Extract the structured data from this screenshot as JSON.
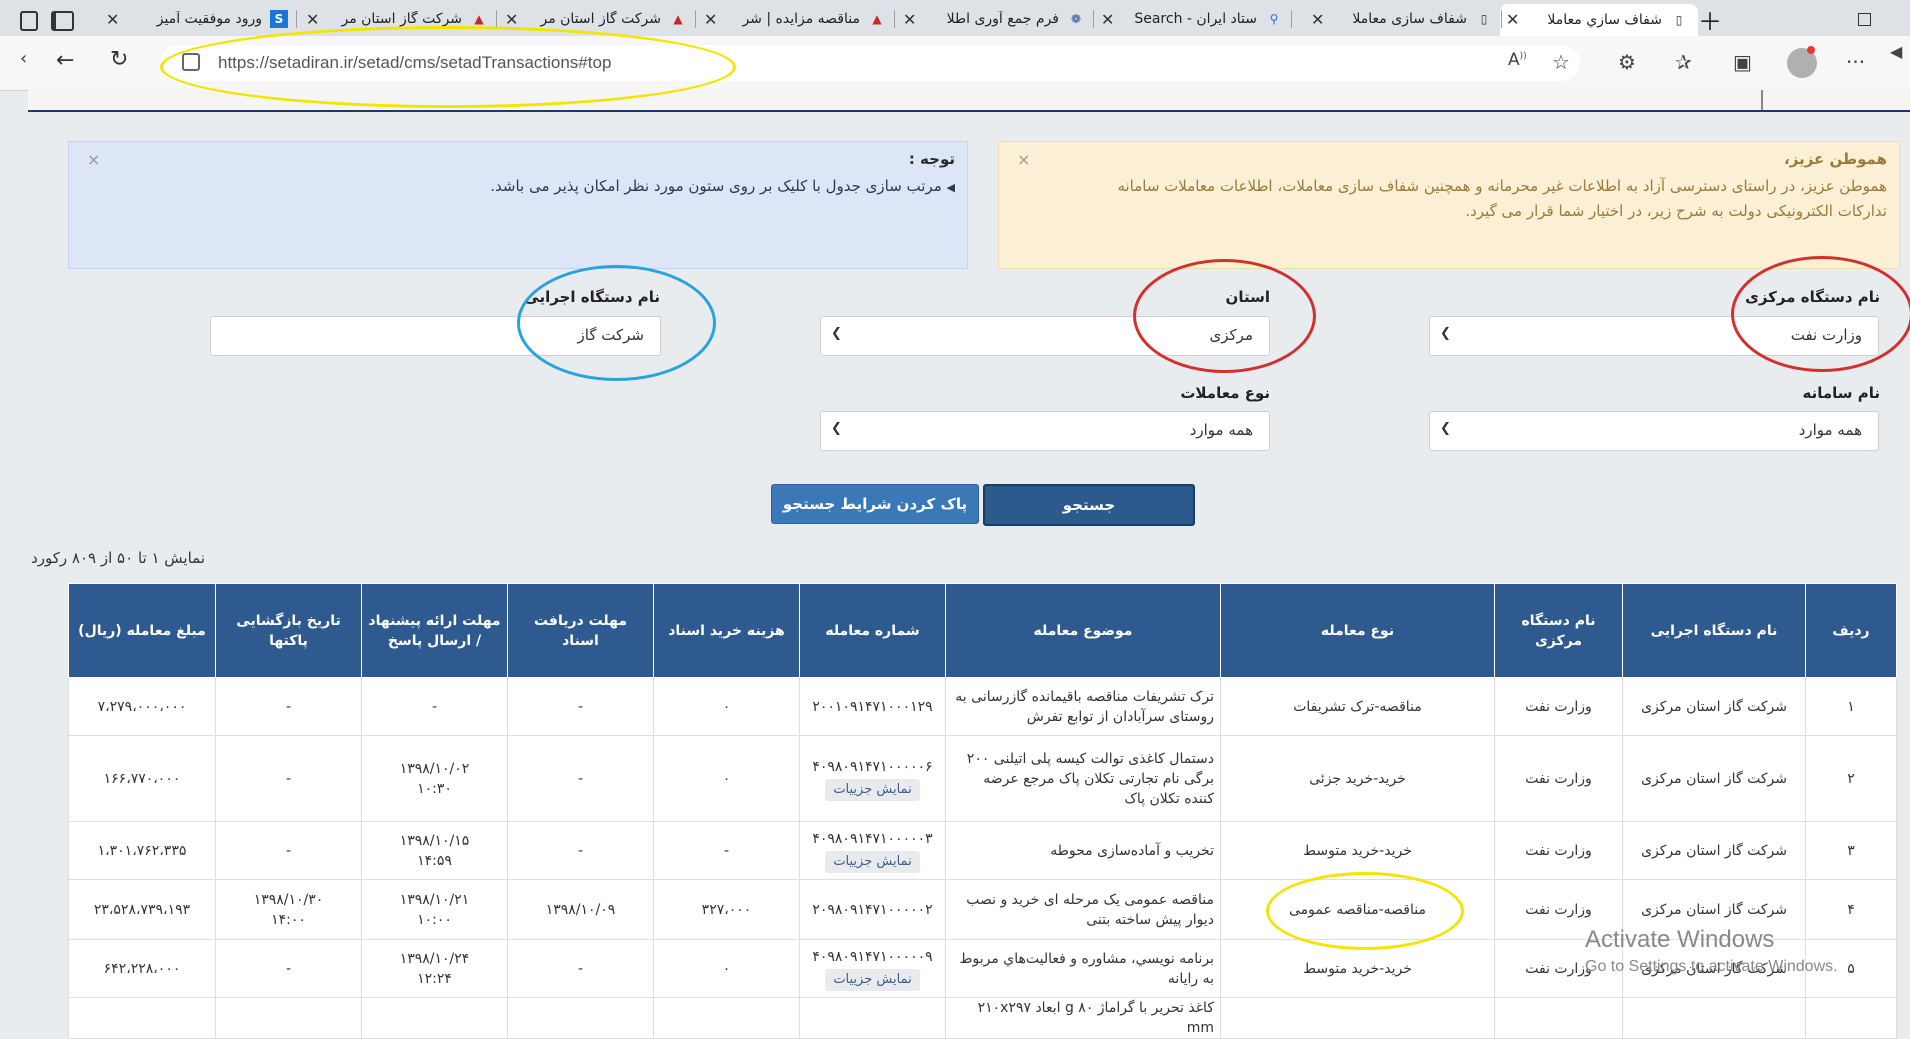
{
  "tabs": [
    {
      "title": "شفاف سازي معاملا",
      "icon": "page-icon"
    },
    {
      "title": "شفاف سازی معاملا",
      "icon": "page-icon"
    },
    {
      "title": "ستاد ایران - Search",
      "icon": "search-icon"
    },
    {
      "title": "فرم جمع آوری اطلا",
      "icon": "emblem-icon"
    },
    {
      "title": "مناقصه مزایده | شر",
      "icon": "gas-logo-icon"
    },
    {
      "title": "شرکت گاز استان مر",
      "icon": "gas-logo-icon"
    },
    {
      "title": "شرکت گاز استان مر",
      "icon": "gas-logo-icon"
    },
    {
      "title": "ورود موفقیت آمیز",
      "icon": "setad-s-icon"
    }
  ],
  "browser": {
    "url": "https://setadiran.ir/setad/cms/setadTransactions#top"
  },
  "notice_attention": {
    "title": "توجه :",
    "text": "مرتب سازی جدول با کلیک بر روی ستون مورد نظر امکان پذیر می باشد.",
    "close": "×"
  },
  "notice_citizen": {
    "title": "هموطن عزیز،",
    "text": "هموطن عزیز، در راستای دسترسی آزاد به اطلاعات غیر محرمانه و همچنین شفاف سازی معاملات، اطلاعات معاملات سامانه تدارکات الکترونیکی دولت به شرح زیر، در اختیار شما قرار می گیرد.",
    "close": "×"
  },
  "filters": {
    "central_org": {
      "label": "نام دستگاه مرکزی",
      "value": "وزارت نفت"
    },
    "province": {
      "label": "استان",
      "value": "مرکزی"
    },
    "exec_org": {
      "label": "نام دستگاه اجرایی",
      "value": "شرکت گاز"
    },
    "system": {
      "label": "نام سامانه",
      "value": "همه موارد"
    },
    "transaction_type": {
      "label": "نوع معاملات",
      "value": "همه موارد"
    }
  },
  "buttons": {
    "search": "جستجو",
    "clear": "پاک کردن شرایط جستجو"
  },
  "result_count": "نمایش ۱ تا ۵۰ از ۸۰۹ رکورد",
  "table": {
    "headers": [
      "ردیف",
      "نام دستگاه اجرایی",
      "نام دستگاه مرکزی",
      "نوع معامله",
      "موضوع معامله",
      "شماره معامله",
      "هزینه خرید اسناد",
      "مهلت دریافت اسناد",
      "مهلت ارائه پیشنهاد / ارسال پاسخ",
      "تاریخ بازگشایی پاکتها",
      "مبلغ معامله (ریال)"
    ],
    "detail_label": "نمایش جزییات",
    "rows": [
      {
        "row": "۱",
        "exec": "شرکت گاز استان مرکزی",
        "central": "وزارت نفت",
        "type": "مناقصه-ترک تشریفات",
        "subject": "ترک تشریفات مناقصه باقیمانده گازرسانی به روستای سرآبادان از توابع تفرش",
        "number": "۲۰۰۱۰۹۱۴۷۱۰۰۰۱۲۹",
        "has_detail": false,
        "doc_cost": "۰",
        "doc_deadline": "-",
        "offer_deadline": "-",
        "opening": "-",
        "amount": "۷،۲۷۹،۰۰۰،۰۰۰"
      },
      {
        "row": "۲",
        "exec": "شرکت گاز استان مرکزی",
        "central": "وزارت نفت",
        "type": "خرید-خرید جزئی",
        "subject": "دستمال کاغذی توالت کیسه پلی اتیلنی ۲۰۰ برگی نام تجارتی تکلان پاک مرجع عرضه کننده تکلان پاک",
        "number": "۴۰۹۸۰۹۱۴۷۱۰۰۰۰۰۶",
        "has_detail": true,
        "doc_cost": "۰",
        "doc_deadline": "-",
        "offer_deadline": "۱۳۹۸/۱۰/۰۲\n۱۰:۳۰",
        "opening": "-",
        "amount": "۱۶۶،۷۷۰،۰۰۰"
      },
      {
        "row": "۳",
        "exec": "شرکت گاز استان مرکزی",
        "central": "وزارت نفت",
        "type": "خرید-خرید متوسط",
        "subject": "تخریب و آماده‌سازی محوطه",
        "number": "۴۰۹۸۰۹۱۴۷۱۰۰۰۰۰۳",
        "has_detail": true,
        "doc_cost": "-",
        "doc_deadline": "-",
        "offer_deadline": "۱۳۹۸/۱۰/۱۵\n۱۴:۵۹",
        "opening": "-",
        "amount": "۱،۳۰۱،۷۶۲،۳۳۵"
      },
      {
        "row": "۴",
        "exec": "شرکت گاز استان مرکزی",
        "central": "وزارت نفت",
        "type": "مناقصه-مناقصه عمومی",
        "subject": "مناقصه عمومی یک مرحله ای خرید و نصب دیوار پیش ساخته بتنی",
        "number": "۲۰۹۸۰۹۱۴۷۱۰۰۰۰۰۲",
        "has_detail": false,
        "doc_cost": "۳۲۷،۰۰۰",
        "doc_deadline": "۱۳۹۸/۱۰/۰۹",
        "offer_deadline": "۱۳۹۸/۱۰/۲۱\n۱۰:۰۰",
        "opening": "۱۳۹۸/۱۰/۳۰\n۱۴:۰۰",
        "amount": "۲۳،۵۲۸،۷۳۹،۱۹۳"
      },
      {
        "row": "۵",
        "exec": "شرکت گاز استان مرکزی",
        "central": "وزارت نفت",
        "type": "خرید-خرید متوسط",
        "subject": "برنامه نویسي، مشاوره و فعاليت‌هاي مربوط به رايانه",
        "number": "۴۰۹۸۰۹۱۴۷۱۰۰۰۰۰۹",
        "has_detail": true,
        "doc_cost": "۰",
        "doc_deadline": "-",
        "offer_deadline": "۱۳۹۸/۱۰/۲۴\n۱۲:۲۴",
        "opening": "-",
        "amount": "۶۴۲،۲۲۸،۰۰۰"
      },
      {
        "row": "",
        "exec": "",
        "central": "",
        "type": "",
        "subject": "کاغذ تحریر با گراماژ ۸۰ g ابعاد ۲۱۰x۲۹۷ mm",
        "number": "",
        "has_detail": false,
        "doc_cost": "",
        "doc_deadline": "",
        "offer_deadline": "",
        "opening": "",
        "amount": ""
      }
    ]
  },
  "watermark": {
    "line1": "Activate Windows",
    "line2": "Go to Settings to activate Windows."
  },
  "colors": {
    "table_header": "#2e5a90",
    "search_button": "#2d5a8c",
    "clear_button": "#3a78b8",
    "annotation_yellow": "#f2e600",
    "annotation_red": "#d32f2f",
    "annotation_blue": "#29a3dc"
  }
}
